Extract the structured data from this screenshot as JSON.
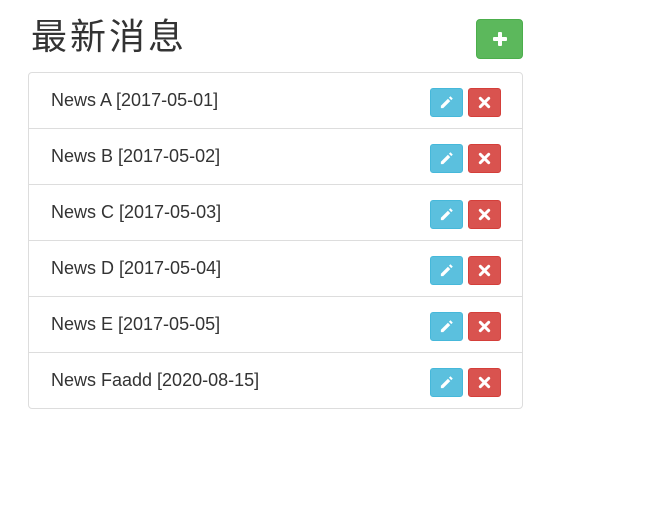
{
  "header": {
    "title": "最新消息",
    "add_icon": "plus-icon"
  },
  "colors": {
    "add_button": "#5cb85c",
    "edit_button": "#5bc0de",
    "delete_button": "#d9534f",
    "border": "#dddddd"
  },
  "icons": {
    "edit": "pencil-icon",
    "delete": "times-icon"
  },
  "news": [
    {
      "label": "News A [2017-05-01]"
    },
    {
      "label": "News B [2017-05-02]"
    },
    {
      "label": "News C [2017-05-03]"
    },
    {
      "label": "News D [2017-05-04]"
    },
    {
      "label": "News E [2017-05-05]"
    },
    {
      "label": "News Faadd [2020-08-15]"
    }
  ]
}
